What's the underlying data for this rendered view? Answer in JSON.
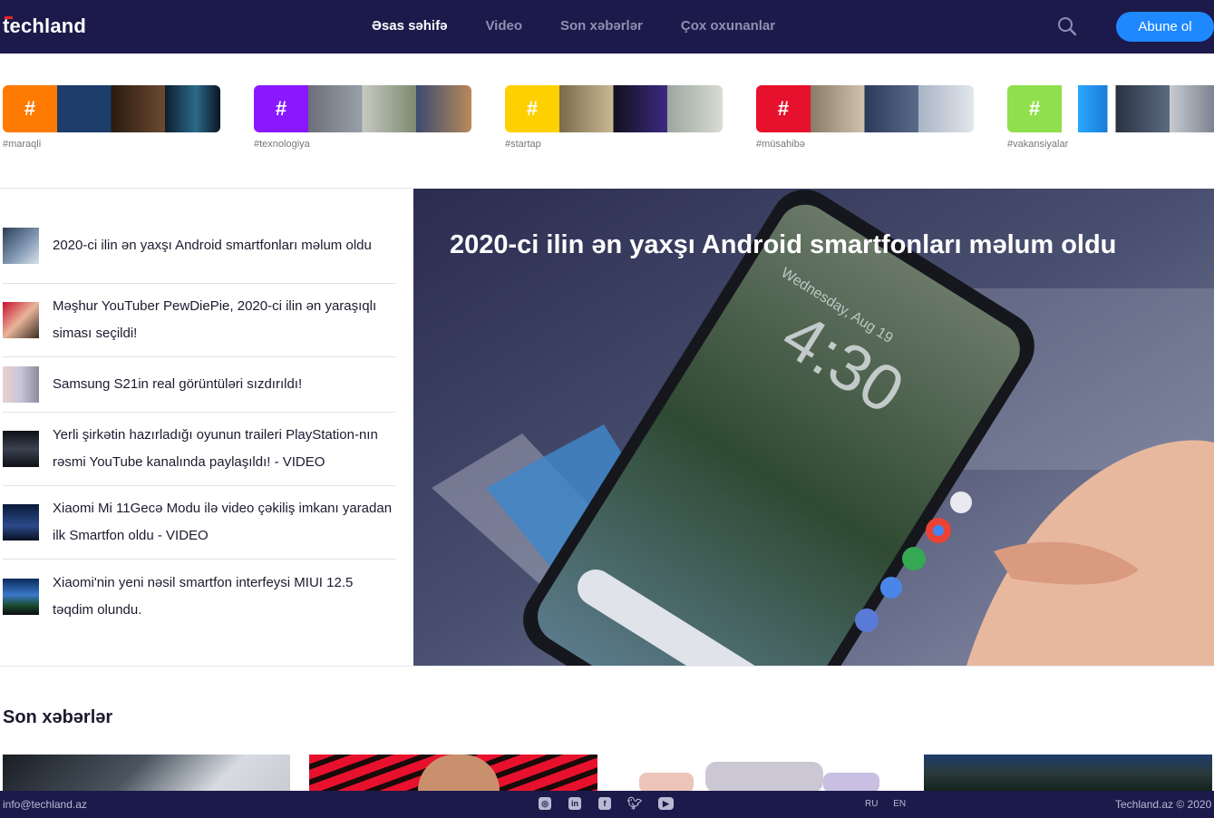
{
  "header": {
    "logo": "techland",
    "nav": [
      "Əsas səhifə",
      "Video",
      "Son xəbərlər",
      "Çox oxunanlar"
    ],
    "subscribe_label": "Abune ol"
  },
  "categories": [
    {
      "tag": "#",
      "label": "#maraqli",
      "color": "#ff7a00"
    },
    {
      "tag": "#",
      "label": "#texnologiya",
      "color": "#8a18ff"
    },
    {
      "tag": "#",
      "label": "#startap",
      "color": "#ffd000"
    },
    {
      "tag": "#",
      "label": "#müsahibə",
      "color": "#e8112d"
    },
    {
      "tag": "#",
      "label": "#vakansiyalar",
      "color": "#8fe04c"
    }
  ],
  "news_list": [
    {
      "title": "2020-ci ilin ən yaxşı Android smartfonları məlum oldu"
    },
    {
      "title": "Məşhur YouTuber PewDiePie, 2020-ci ilin ən yaraşıqlı siması seçildi!"
    },
    {
      "title": "Samsung S21in real görüntüləri sızdırıldı!"
    },
    {
      "title": "Yerli şirkətin hazırladığı oyunun traileri PlayStation-nın rəsmi YouTube kanalında paylaşıldı! - VIDEO"
    },
    {
      "title": "Xiaomi Mi 11Gecə Modu ilə video çəkiliş imkanı yaradan ilk Smartfon oldu - VIDEO"
    },
    {
      "title": "Xiaomi'nin yeni nəsil smartfon interfeysi MIUI 12.5 təqdim olundu."
    }
  ],
  "hero": {
    "title": "2020-ci ilin ən yaxşı Android smartfonları məlum oldu",
    "phone_time": "4:30",
    "phone_date": "Wednesday, Aug 19"
  },
  "latest": {
    "title": "Son xəbərlər"
  },
  "footer": {
    "email": "info@techland.az",
    "languages": [
      "RU",
      "EN"
    ],
    "copyright": "Techland.az © 2020"
  }
}
